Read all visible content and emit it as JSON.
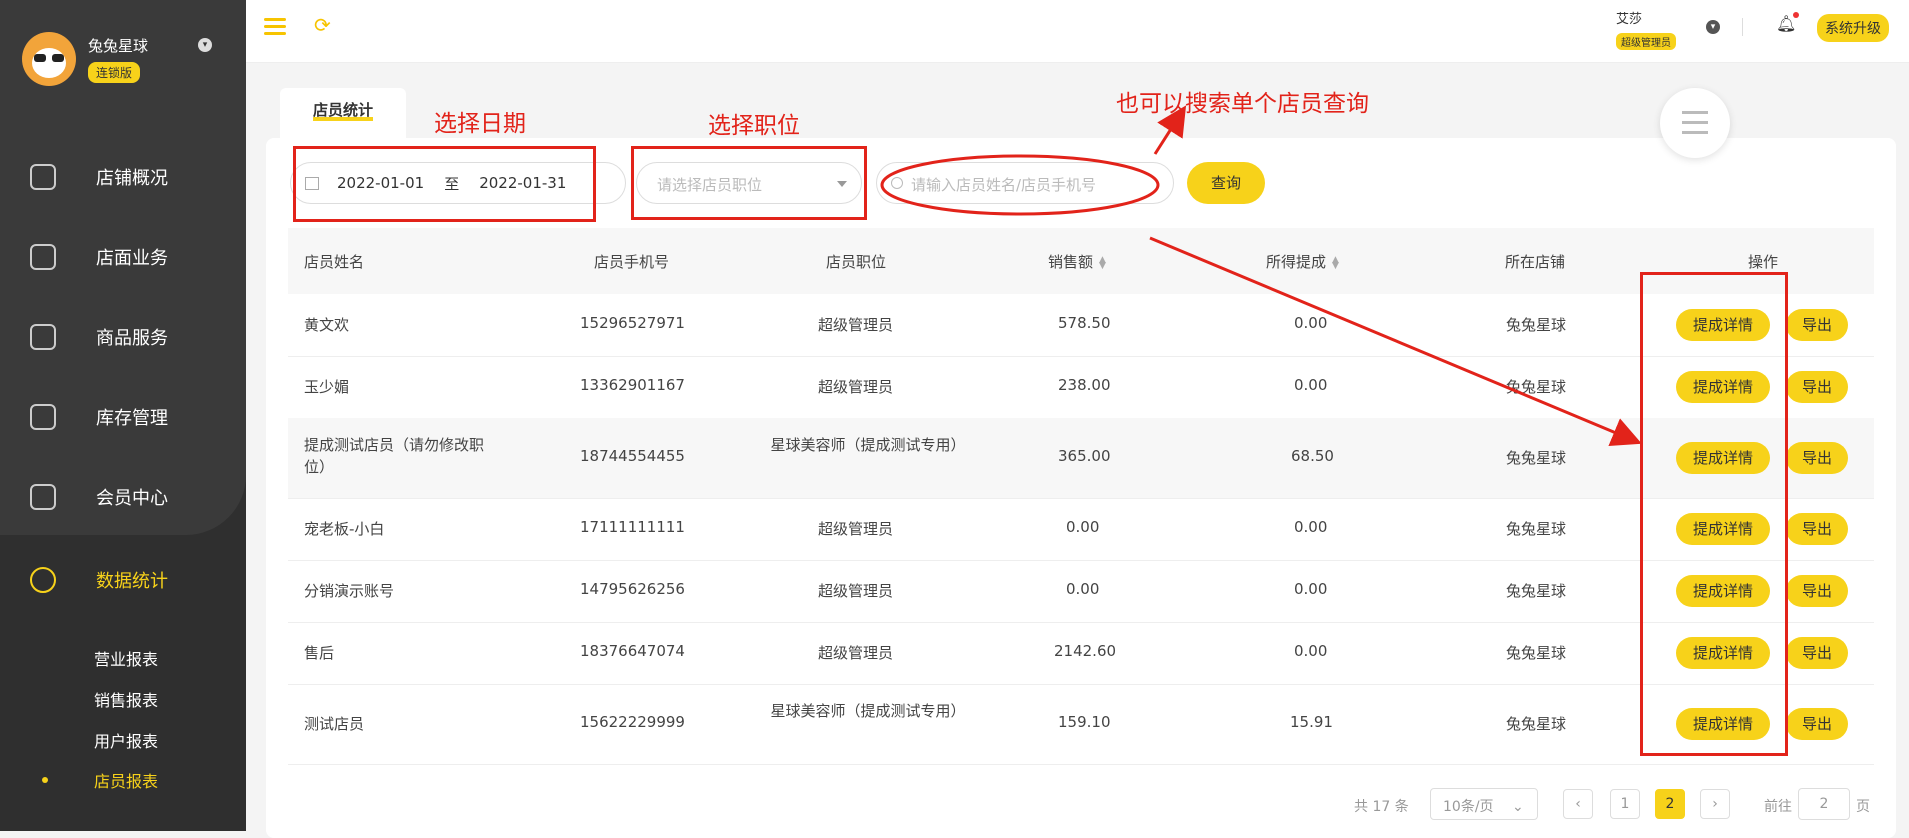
{
  "sidebar": {
    "brand_name": "兔兔星球",
    "brand_badge": "连锁版",
    "menu": [
      {
        "label": "店铺概况",
        "icon": "monitor-icon"
      },
      {
        "label": "店面业务",
        "icon": "home-icon"
      },
      {
        "label": "商品服务",
        "icon": "bag-icon"
      },
      {
        "label": "库存管理",
        "icon": "box-icon"
      },
      {
        "label": "会员中心",
        "icon": "member-icon"
      },
      {
        "label": "数据统计",
        "icon": "chart-icon",
        "active": true
      }
    ],
    "submenu": [
      "营业报表",
      "销售报表",
      "用户报表",
      "店员报表"
    ],
    "current_submenu": "店员报表"
  },
  "topbar": {
    "user_name": "艾莎",
    "user_role": "超级管理员",
    "upgrade_label": "系统升级"
  },
  "tab": {
    "label": "店员统计"
  },
  "filters": {
    "date_start": "2022-01-01",
    "date_sep": "至",
    "date_end": "2022-01-31",
    "position_placeholder": "请选择店员职位",
    "search_placeholder": "请输入店员姓名/店员手机号",
    "query_label": "查询"
  },
  "table": {
    "headers": [
      "店员姓名",
      "店员手机号",
      "店员职位",
      "销售额",
      "所得提成",
      "所在店铺",
      "操作"
    ],
    "rows": [
      [
        "黄文欢",
        "15296527971",
        "超级管理员",
        "578.50",
        "0.00",
        "兔兔星球"
      ],
      [
        "玉少媚",
        "13362901167",
        "超级管理员",
        "238.00",
        "0.00",
        "兔兔星球"
      ],
      [
        "提成测试店员（请勿修改职位）",
        "18744554455",
        "星球美容师（提成测试专用）",
        "365.00",
        "68.50",
        "兔兔星球"
      ],
      [
        "宠老板-小白",
        "17111111111",
        "超级管理员",
        "0.00",
        "0.00",
        "兔兔星球"
      ],
      [
        "分销演示账号",
        "14795626256",
        "超级管理员",
        "0.00",
        "0.00",
        "兔兔星球"
      ],
      [
        "售后",
        "18376647074",
        "超级管理员",
        "2142.60",
        "0.00",
        "兔兔星球"
      ],
      [
        "测试店员",
        "15622229999",
        "星球美容师（提成测试专用）",
        "159.10",
        "15.91",
        "兔兔星球"
      ]
    ],
    "detail_label": "提成详情",
    "export_label": "导出"
  },
  "pagination": {
    "total": "共 17 条",
    "page_size": "10条/页",
    "pages": [
      "1",
      "2"
    ],
    "current_page": "2",
    "goto_label": "前往",
    "goto_value": "2",
    "page_suffix": "页"
  },
  "annotations": {
    "select_date": "选择日期",
    "select_position": "选择职位",
    "search_single": "也可以搜索单个店员查询"
  },
  "colors": {
    "accent": "#f7d21a",
    "annotation": "#e2231a",
    "sidebar": "#2f2f2f"
  }
}
